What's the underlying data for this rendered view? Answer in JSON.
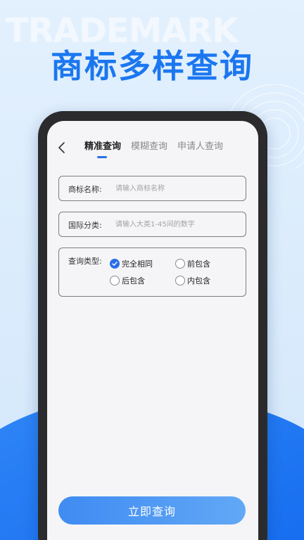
{
  "banner": {
    "watermark": "TRADEMARK",
    "headline": "商标多样查询"
  },
  "nav": {
    "tabs": [
      {
        "label": "精准查询",
        "active": true
      },
      {
        "label": "模糊查询",
        "active": false
      },
      {
        "label": "申请人查询",
        "active": false
      }
    ]
  },
  "form": {
    "name": {
      "label": "商标名称:",
      "placeholder": "请输入商标名称",
      "value": ""
    },
    "class": {
      "label": "国际分类:",
      "placeholder": "请输入大类1-45间的数字",
      "value": ""
    },
    "type": {
      "label": "查询类型:",
      "options": [
        {
          "label": "完全相同",
          "checked": true
        },
        {
          "label": "前包含",
          "checked": false
        },
        {
          "label": "后包含",
          "checked": false
        },
        {
          "label": "内包含",
          "checked": false
        }
      ]
    },
    "submit_label": "立即查询"
  },
  "colors": {
    "accent": "#1b77f0",
    "button_start": "#3f8bf2",
    "button_end": "#62a8f6"
  }
}
